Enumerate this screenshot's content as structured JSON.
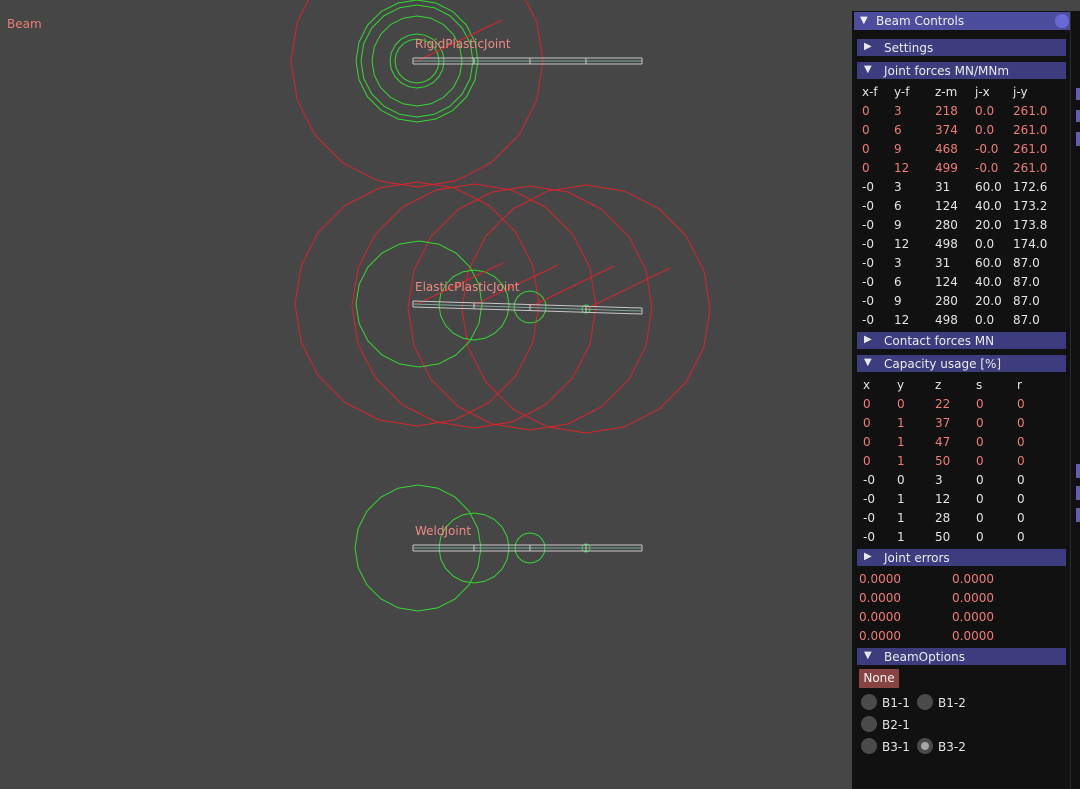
{
  "app": {
    "title": "Beam"
  },
  "scene": {
    "labels": [
      "RigidPlasticJoint",
      "ElasticPlasticJoint",
      "WeldJoint"
    ],
    "colors": {
      "background": "#464646",
      "stress": "#d8252b",
      "deflection": "#34d834",
      "beam": "#c8c8c8"
    }
  },
  "panel": {
    "title": "Beam Controls",
    "sections": {
      "settings": "Settings",
      "joint_forces": "Joint forces MN/MNm",
      "contact_forces": "Contact forces MN",
      "capacity": "Capacity usage [%]",
      "joint_errors": "Joint errors",
      "beam_options": "BeamOptions"
    },
    "joint_forces": {
      "headers": [
        "x-f",
        "y-f",
        "z-m",
        "j-x",
        "j-y"
      ],
      "rows": [
        [
          "0",
          "3",
          "218",
          "0.0",
          "261.0"
        ],
        [
          "0",
          "6",
          "374",
          "0.0",
          "261.0"
        ],
        [
          "0",
          "9",
          "468",
          "-0.0",
          "261.0"
        ],
        [
          "0",
          "12",
          "499",
          "-0.0",
          "261.0"
        ],
        [
          "-0",
          "3",
          "31",
          "60.0",
          "172.6"
        ],
        [
          "-0",
          "6",
          "124",
          "40.0",
          "173.2"
        ],
        [
          "-0",
          "9",
          "280",
          "20.0",
          "173.8"
        ],
        [
          "-0",
          "12",
          "498",
          "0.0",
          "174.0"
        ],
        [
          "-0",
          "3",
          "31",
          "60.0",
          "87.0"
        ],
        [
          "-0",
          "6",
          "124",
          "40.0",
          "87.0"
        ],
        [
          "-0",
          "9",
          "280",
          "20.0",
          "87.0"
        ],
        [
          "-0",
          "12",
          "498",
          "0.0",
          "87.0"
        ]
      ]
    },
    "capacity": {
      "headers": [
        "x",
        "y",
        "z",
        "s",
        "r"
      ],
      "rows": [
        [
          "0",
          "0",
          "22",
          "0",
          "0"
        ],
        [
          "0",
          "1",
          "37",
          "0",
          "0"
        ],
        [
          "0",
          "1",
          "47",
          "0",
          "0"
        ],
        [
          "0",
          "1",
          "50",
          "0",
          "0"
        ],
        [
          "-0",
          "0",
          "3",
          "0",
          "0"
        ],
        [
          "-0",
          "1",
          "12",
          "0",
          "0"
        ],
        [
          "-0",
          "1",
          "28",
          "0",
          "0"
        ],
        [
          "-0",
          "1",
          "50",
          "0",
          "0"
        ]
      ]
    },
    "joint_errors": {
      "rows": [
        [
          "0.0000",
          "0.0000"
        ],
        [
          "0.0000",
          "0.0000"
        ],
        [
          "0.0000",
          "0.0000"
        ],
        [
          "0.0000",
          "0.0000"
        ]
      ]
    },
    "beam_options": {
      "none_button": "None",
      "options": [
        {
          "label": "B1-1",
          "selected": false
        },
        {
          "label": "B1-2",
          "selected": false
        },
        {
          "label": "B2-1",
          "selected": false
        },
        {
          "label": "B3-1",
          "selected": false
        },
        {
          "label": "B3-2",
          "selected": true
        }
      ]
    }
  }
}
